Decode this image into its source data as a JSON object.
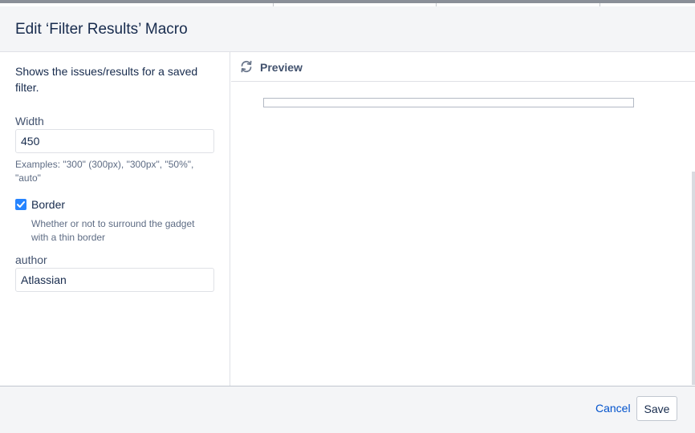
{
  "dialog": {
    "title": "Edit ‘Filter Results’ Macro"
  },
  "left_panel": {
    "description": "Shows the issues/results for a saved filter.",
    "width_field": {
      "label": "Width",
      "value": "450",
      "hint": "Examples: \"300\" (300px), \"300px\", \"50%\", \"auto\""
    },
    "border_field": {
      "label": "Border",
      "checked": true,
      "hint": "Whether or not to surround the gadget with a thin border"
    },
    "author_field": {
      "label": "author",
      "value": "Atlassian"
    }
  },
  "preview": {
    "label": "Preview",
    "icon": "refresh-icon"
  },
  "footer": {
    "cancel_label": "Cancel",
    "save_label": "Save"
  },
  "colors": {
    "link": "#0052cc",
    "checkbox": "#2684ff",
    "header_bg": "#f4f5f7"
  }
}
